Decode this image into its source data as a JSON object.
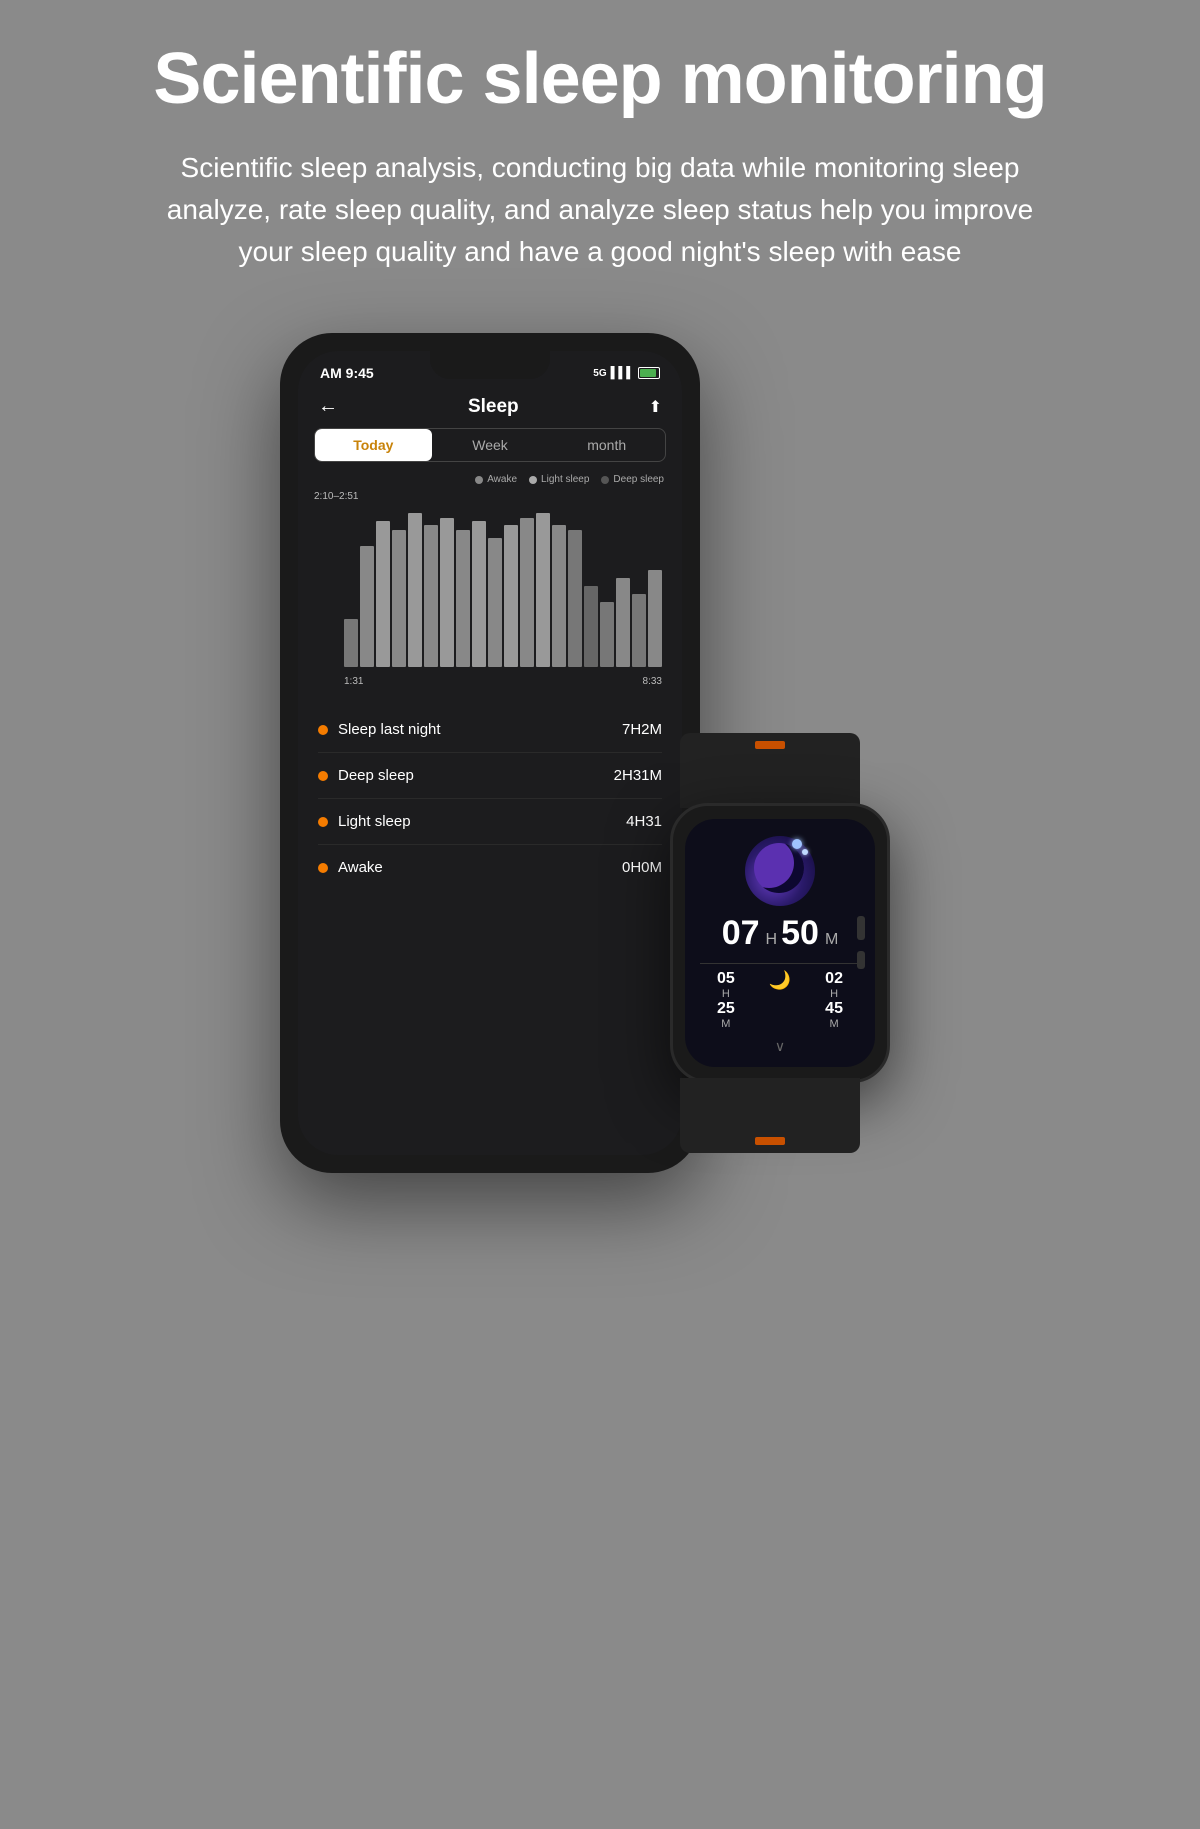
{
  "page": {
    "background": "#8a8a8a",
    "main_title": "Scientific sleep monitoring",
    "subtitle": "Scientific sleep analysis, conducting big data while monitoring sleep analyze, rate sleep quality, and analyze sleep status help you improve your sleep quality and have a good night's sleep with ease"
  },
  "phone": {
    "status_time": "AM 9:45",
    "app_title": "Sleep",
    "back_label": "←",
    "share_label": "⬆",
    "tabs": [
      {
        "label": "Today",
        "active": true
      },
      {
        "label": "Week",
        "active": false
      },
      {
        "label": "month",
        "active": false
      }
    ],
    "legend": [
      {
        "label": "Awake",
        "color": "#888"
      },
      {
        "label": "Light sleep",
        "color": "#aaa"
      },
      {
        "label": "Deep sleep",
        "color": "#555"
      }
    ],
    "chart": {
      "range_label": "2:10–2:51",
      "time_start": "1:31",
      "time_end": "8:33"
    },
    "stats": [
      {
        "label": "Sleep last night",
        "value": "7H2M",
        "dot_color": "#f57c00"
      },
      {
        "label": "Deep sleep",
        "value": "2H31M",
        "dot_color": "#f57c00"
      },
      {
        "label": "Light sleep",
        "value": "4H31",
        "dot_color": "#f57c00"
      },
      {
        "label": "Awake",
        "value": "0H0M",
        "dot_color": "#f57c00"
      }
    ]
  },
  "watch": {
    "time_hours": "07",
    "time_h_label": "H",
    "time_minutes": "50",
    "time_m_label": "M",
    "sub1_hours": "05",
    "sub1_h": "H",
    "sub1_minutes": "25",
    "sub1_m": "M",
    "sub2_hours": "02",
    "sub2_h": "H",
    "sub2_minutes": "45",
    "sub2_m": "M",
    "chevron": "∨"
  },
  "colors": {
    "accent_orange": "#f57c00",
    "tab_active_text": "#c8830a",
    "phone_bg": "#1c1c1e",
    "watch_bg": "#0d0d1a"
  }
}
